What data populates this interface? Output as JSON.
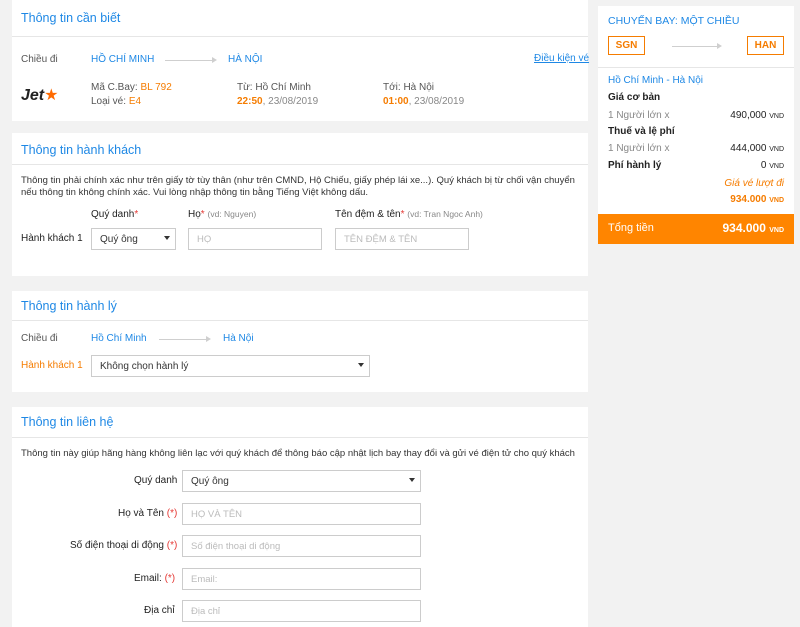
{
  "info": {
    "title": "Thông tin cần biết",
    "direction_label": "Chiều đi",
    "from_city": "HỒ CHÍ MINH",
    "to_city": "HÀ NỘI",
    "conditions_link": "Điều kiện vé",
    "airline_logo": "Jet",
    "flight_code_label": "Mã C.Bay:",
    "flight_code": "BL 792",
    "fare_type_label": "Loại vé:",
    "fare_type": "E4",
    "from_label": "Từ: Hồ Chí Minh",
    "depart_time": "22:50",
    "depart_date": ", 23/08/2019",
    "to_label": "Tới: Hà Nội",
    "arrive_time": "01:00",
    "arrive_date": ", 23/08/2019"
  },
  "passenger": {
    "title": "Thông tin hành khách",
    "notice": "Thông tin phải chính xác như trên giấy tờ tùy thân (như trên CMND, Hộ Chiếu, giấy phép lái xe...). Quý khách bị từ chối vận chuyển nếu thông tin không chính xác. Vui lòng nhập thông tin bằng Tiếng Việt không dấu.",
    "col_title_label": "Quý danh",
    "col_last_label": "Họ",
    "col_last_hint": "(vd: Nguyen)",
    "col_first_label": "Tên đệm & tên",
    "col_first_hint": "(vd: Tran Ngoc Anh)",
    "required_mark": "*",
    "row_label": "Hành khách 1",
    "title_value": "Quý ông",
    "last_placeholder": "HỌ",
    "first_placeholder": "TÊN ĐỆM & TÊN"
  },
  "baggage": {
    "title": "Thông tin hành lý",
    "direction_label": "Chiều đi",
    "from_city": "Hồ Chí Minh",
    "to_city": "Hà Nội",
    "row_label": "Hành khách 1",
    "select_value": "Không chọn hành lý"
  },
  "contact": {
    "title": "Thông tin liên hệ",
    "notice": "Thông tin này giúp hãng hàng không liên lạc với quý khách để thông báo cập nhật lịch bay thay đổi và gửi vé điện tử cho quý khách",
    "title_label": "Quý danh",
    "title_value": "Quý ông",
    "name_label": "Họ và Tên",
    "name_placeholder": "HỌ VÀ TÊN",
    "phone_label": "Số điện thoại di động",
    "phone_placeholder": "Số điện thoại di động",
    "email_label": "Email:",
    "email_placeholder": "Email:",
    "address_label": "Địa chỉ",
    "address_placeholder": "Địa chỉ",
    "required_mark": "(*)"
  },
  "summary": {
    "heading": "CHUYẾN BAY: MỘT CHIỀU",
    "from_code": "SGN",
    "to_code": "HAN",
    "route": "Hồ Chí Minh - Hà Nội",
    "base_fare_label": "Giá cơ bản",
    "base_fare_qty": "1 Người lớn x",
    "base_fare_value": "490,000",
    "tax_label": "Thuế và lệ phí",
    "tax_qty": "1 Người lớn x",
    "tax_value": "444,000",
    "baggage_fee_label": "Phí hành lý",
    "baggage_fee_value": "0",
    "currency": "VND",
    "outbound_label": "Giá vé lượt đi",
    "outbound_value": "934.000",
    "total_label": "Tổng tiền",
    "total_value": "934.000"
  },
  "colors": {
    "accent_blue": "#1e88e5",
    "accent_orange": "#f57c00",
    "total_bar": "#ff8500",
    "jetstar_orange": "#ff6a00"
  }
}
